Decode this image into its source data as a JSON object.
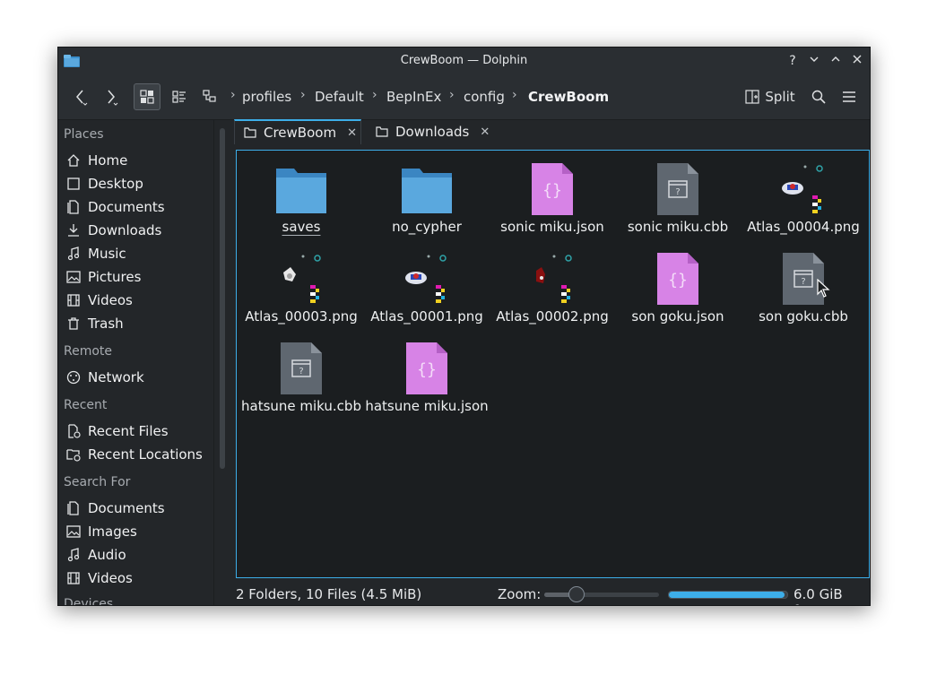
{
  "window": {
    "title": "CrewBoom — Dolphin"
  },
  "titlebar": {
    "help": "?",
    "minimize": "⌄",
    "maximize": "⌃",
    "close": "✕"
  },
  "toolbar": {
    "split_label": "Split",
    "breadcrumb": [
      "profiles",
      "Default",
      "BepInEx",
      "config",
      "CrewBoom"
    ]
  },
  "sidebar": {
    "places_header": "Places",
    "places": [
      "Home",
      "Desktop",
      "Documents",
      "Downloads",
      "Music",
      "Pictures",
      "Videos",
      "Trash"
    ],
    "remote_header": "Remote",
    "remote": [
      "Network"
    ],
    "recent_header": "Recent",
    "recent": [
      "Recent Files",
      "Recent Locations"
    ],
    "search_header": "Search For",
    "search": [
      "Documents",
      "Images",
      "Audio",
      "Videos"
    ],
    "devices_header": "Devices"
  },
  "tabs": [
    {
      "label": "CrewBoom",
      "active": true
    },
    {
      "label": "Downloads",
      "active": false
    }
  ],
  "files": [
    {
      "name": "saves",
      "type": "folder"
    },
    {
      "name": "no_cypher",
      "type": "folder"
    },
    {
      "name": "sonic miku.json",
      "type": "json"
    },
    {
      "name": "sonic miku.cbb",
      "type": "cbb"
    },
    {
      "name": "Atlas_00004.png",
      "type": "atlas"
    },
    {
      "name": "Atlas_00003.png",
      "type": "atlas"
    },
    {
      "name": "Atlas_00001.png",
      "type": "atlas"
    },
    {
      "name": "Atlas_00002.png",
      "type": "atlas"
    },
    {
      "name": "son goku.json",
      "type": "json"
    },
    {
      "name": "son goku.cbb",
      "type": "cbb"
    },
    {
      "name": "hatsune miku.cbb",
      "type": "cbb"
    },
    {
      "name": "hatsune miku.json",
      "type": "json"
    }
  ],
  "status": {
    "summary": "2 Folders, 10 Files (4.5 MiB)",
    "zoom_label": "Zoom:",
    "zoom_fraction": 0.28,
    "space_used_fraction": 0.98,
    "free_label": "6.0 GiB free"
  },
  "colors": {
    "accent": "#3daee9",
    "folder": "#5aa8de",
    "json_icon": "#d783e6",
    "cbb_icon": "#5f6770"
  }
}
